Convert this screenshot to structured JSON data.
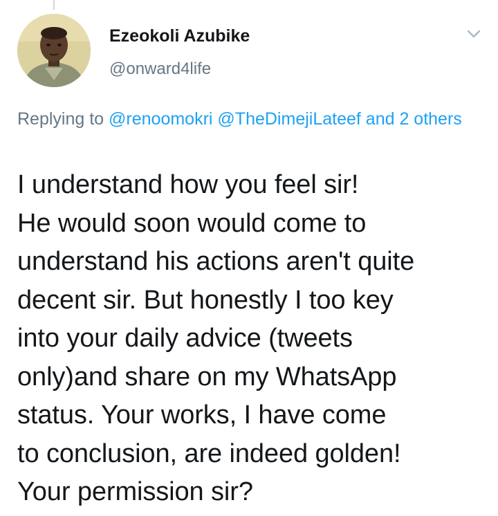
{
  "author": {
    "display_name": "Ezeokoli Azubike",
    "handle": "@onward4life",
    "avatar_icon": "profile-photo"
  },
  "menu": {
    "caret_icon": "chevron-down-icon"
  },
  "reply": {
    "prefix": "Replying to ",
    "mention_1": "@renoomokri",
    "mention_2": "@TheDimejiLateef",
    "suffix": "and 2 others"
  },
  "tweet": {
    "lines": [
      "I understand how you feel sir!",
      "He would soon would come to",
      "understand his actions aren't quite",
      "decent sir. But honestly I too key",
      "into your daily advice (tweets",
      "only)and share on my WhatsApp",
      "status. Your works, I have come",
      "to conclusion, are indeed golden!",
      "Your permission sir?"
    ]
  },
  "colors": {
    "link": "#1da1f2",
    "secondary": "#657786",
    "text": "#14171a"
  }
}
